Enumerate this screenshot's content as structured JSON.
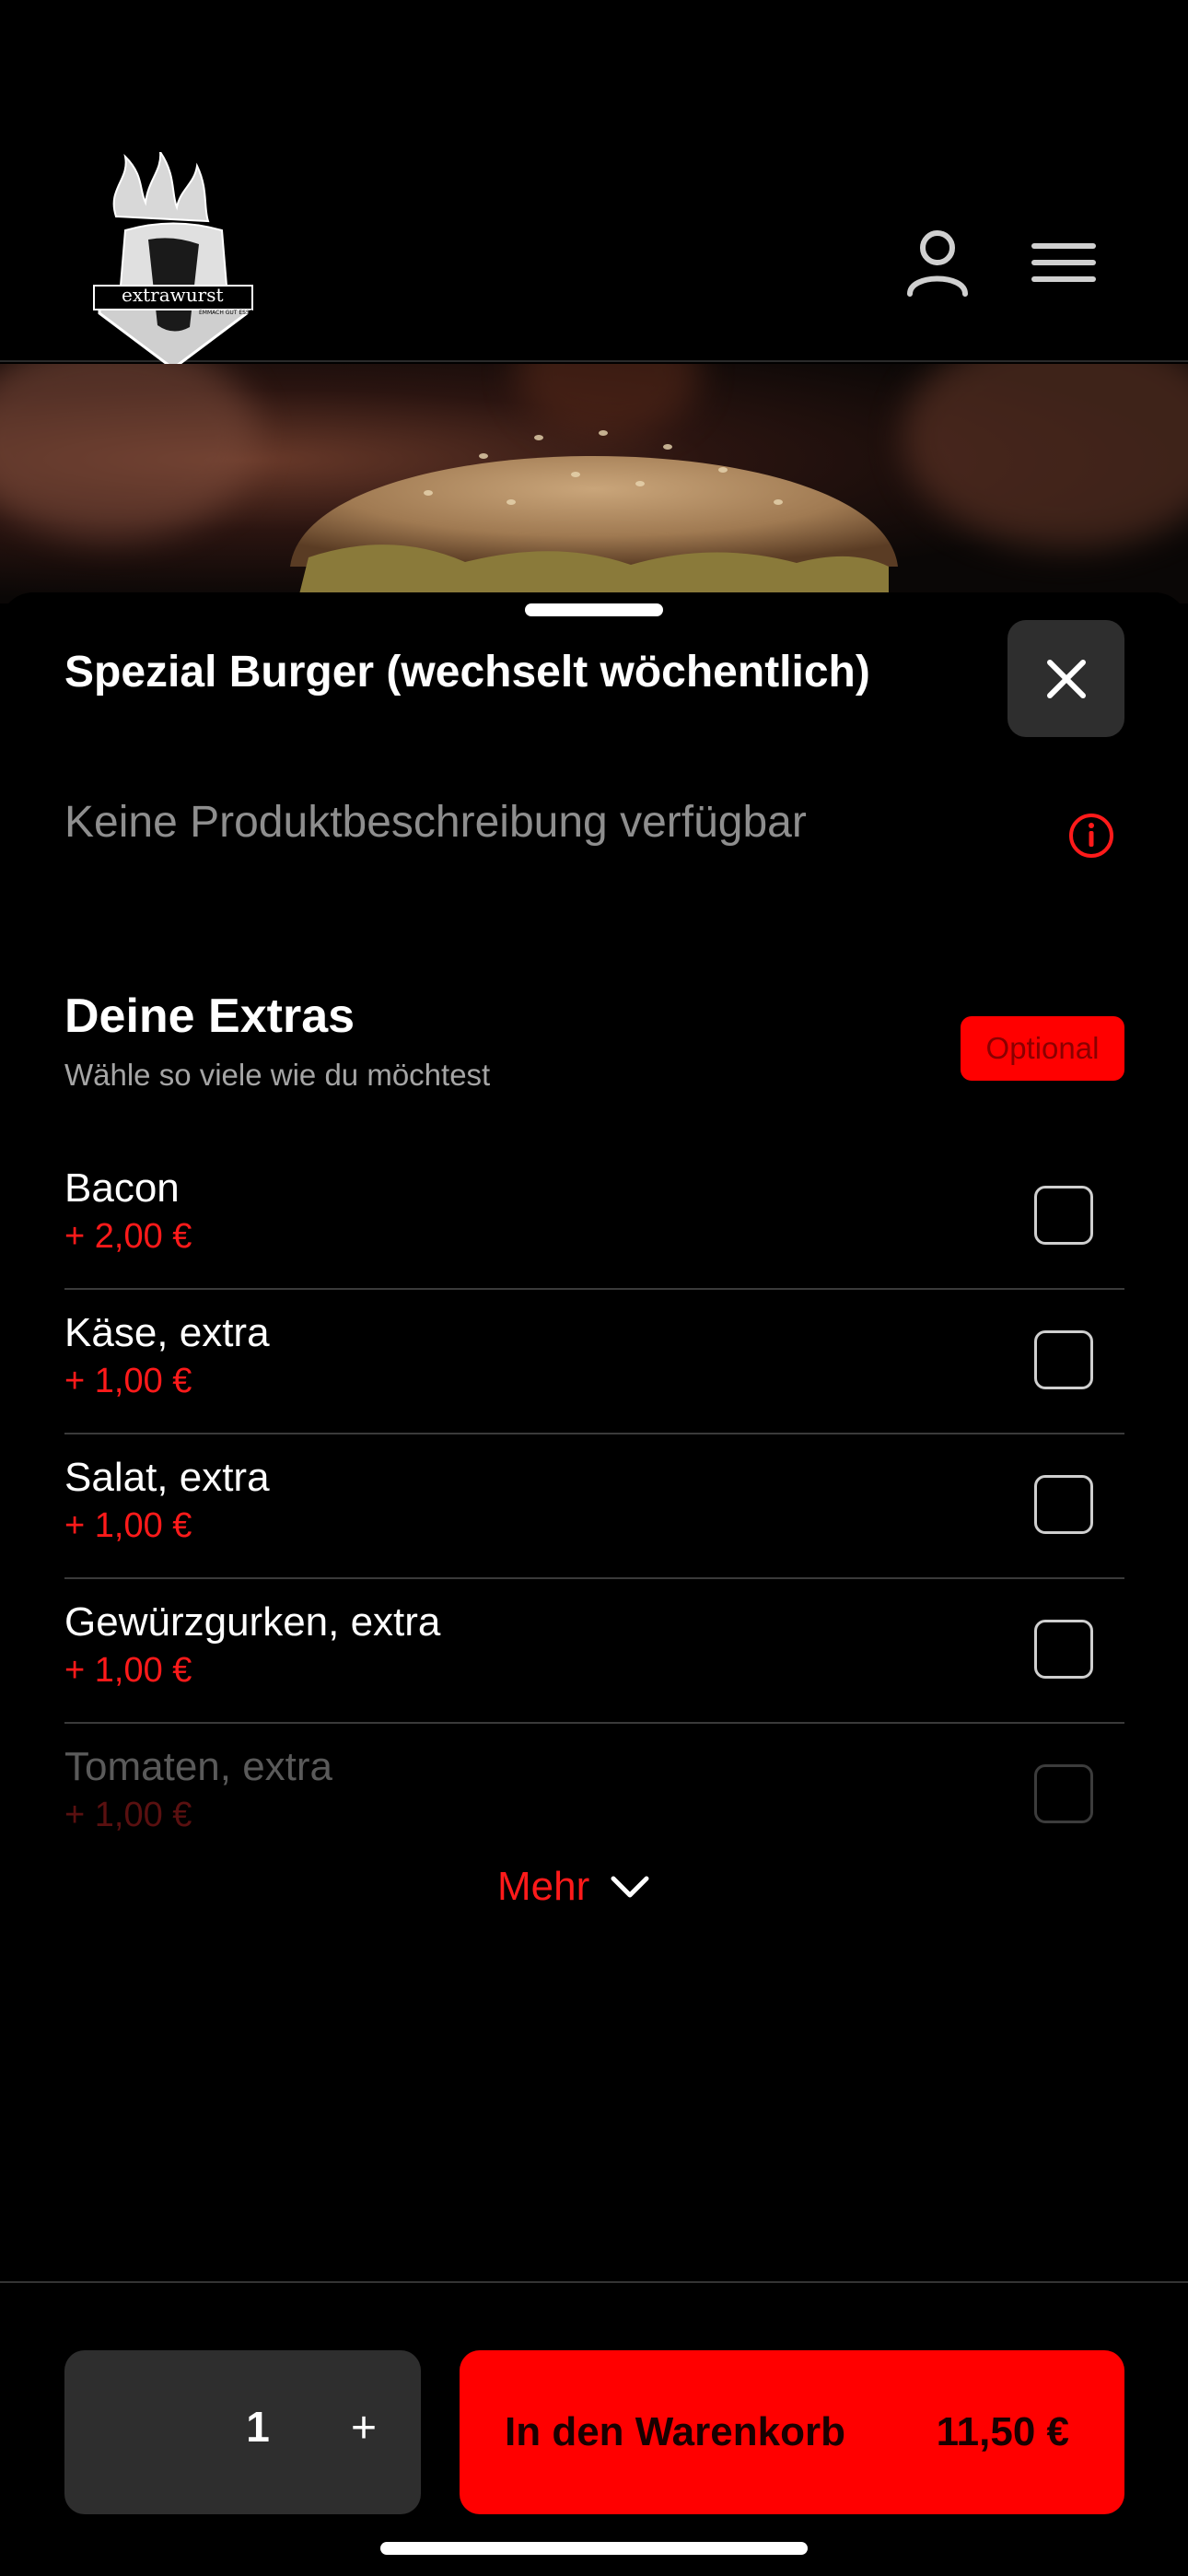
{
  "header": {
    "logo_text": "extrawurst",
    "logo_tagline": "EMMACH GUT ESSEN",
    "account_icon": "person-icon",
    "menu_icon": "hamburger-menu-icon"
  },
  "product": {
    "title": "Spezial Burger (wechselt wöchentlich)",
    "description": "Keine Produktbeschreibung verfügbar",
    "close_icon": "close-icon",
    "info_icon": "info-icon"
  },
  "extras_section": {
    "title": "Deine Extras",
    "subtitle": "Wähle so viele wie du möchtest",
    "badge": "Optional",
    "items": [
      {
        "name": "Bacon",
        "price": "+ 2,00 €",
        "checked": false
      },
      {
        "name": "Käse, extra",
        "price": "+ 1,00 €",
        "checked": false
      },
      {
        "name": "Salat, extra",
        "price": "+ 1,00 €",
        "checked": false
      },
      {
        "name": "Gewürzgurken, extra",
        "price": "+ 1,00 €",
        "checked": false
      },
      {
        "name": "Tomaten, extra",
        "price": "+ 1,00 €",
        "checked": false
      }
    ],
    "more_label": "Mehr"
  },
  "footer": {
    "quantity": "1",
    "plus": "+",
    "cart_label": "In den Warenkorb",
    "cart_price": "11,50 €"
  },
  "colors": {
    "accent": "#ff0000",
    "background": "#000000",
    "surface": "#2e2e2e"
  }
}
